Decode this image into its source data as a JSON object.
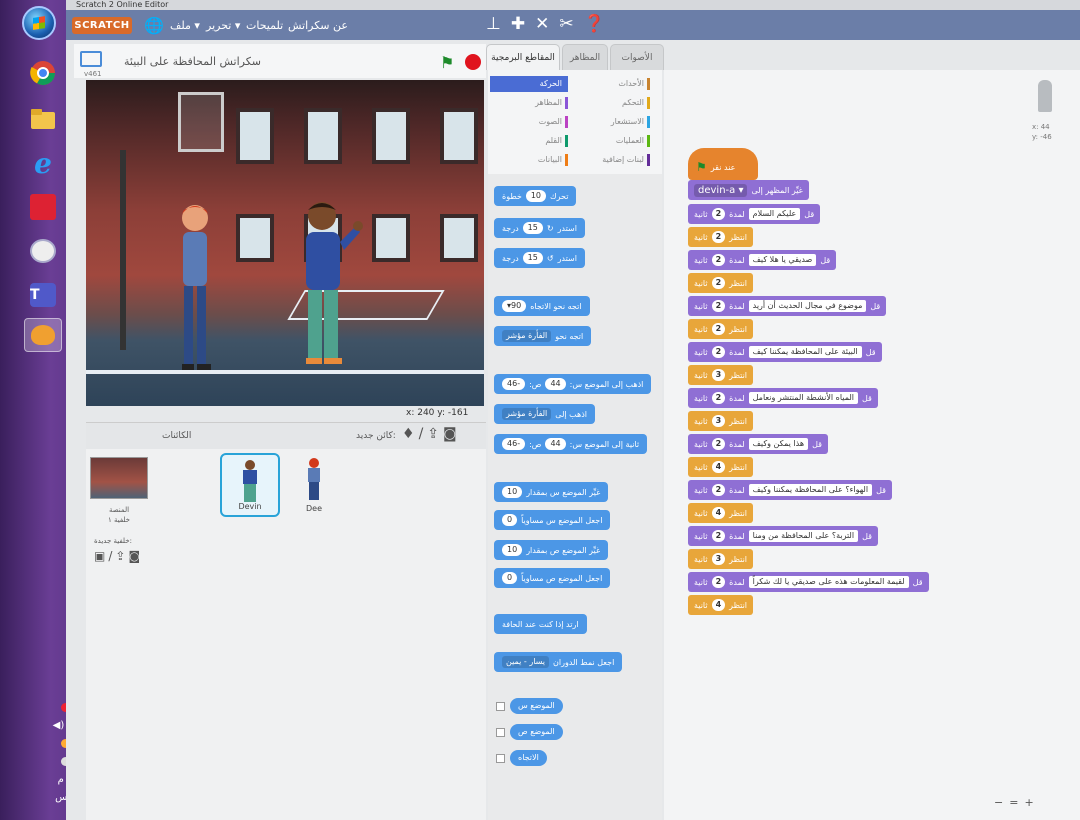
{
  "window": {
    "title": "Scratch 2 Online Editor"
  },
  "taskbar": {
    "language": "EN",
    "clock": "٦:١٥ م",
    "day": "الخميس"
  },
  "menubar": {
    "logo": "SCRATCH",
    "file": "ملف ▾",
    "edit": "تحرير ▾",
    "tips": "تلميحات",
    "about": "عن سكراتش"
  },
  "stage": {
    "project_name": "سكراتش المحافظة على البيئة",
    "version": "v461",
    "x_label": "x:",
    "x_value": "240",
    "y_label": "y:",
    "y_value": "-161"
  },
  "sprites": {
    "header": "الكائنات",
    "new_sprite": "كائن جديد:",
    "stage_label": "المنصة",
    "stage_backdrops": "خلفية ١",
    "new_backdrop": "خلفية جديدة:",
    "items": [
      {
        "name": "Devin"
      },
      {
        "name": "Dee"
      }
    ]
  },
  "tabs": {
    "scripts": "المقاطع البرمجية",
    "costumes": "المظاهر",
    "sounds": "الأصوات"
  },
  "categories": [
    {
      "label": "الحركة",
      "color": "#4a6cd4",
      "active": true
    },
    {
      "label": "الأحداث",
      "color": "#c88330"
    },
    {
      "label": "المظاهر",
      "color": "#8a55d7"
    },
    {
      "label": "التحكم",
      "color": "#e1a91a"
    },
    {
      "label": "الصوت",
      "color": "#bb42c3"
    },
    {
      "label": "الاستشعار",
      "color": "#2ca5e2"
    },
    {
      "label": "القلم",
      "color": "#0e9a6c"
    },
    {
      "label": "العمليات",
      "color": "#5cb712"
    },
    {
      "label": "البيانات",
      "color": "#ee7d16"
    },
    {
      "label": "لبنات إضافية",
      "color": "#632d99"
    }
  ],
  "palette": {
    "move": {
      "a": "تحرك",
      "n": "10",
      "b": "خطوة"
    },
    "turn_right": {
      "a": "استدر",
      "n": "15",
      "b": "درجة"
    },
    "turn_left": {
      "a": "استدر",
      "n": "15",
      "b": "درجة"
    },
    "point_dir": {
      "a": "اتجه نحو الاتجاه",
      "n": "90▾"
    },
    "point_towards": {
      "a": "اتجه نحو",
      "d": "الفأرة مؤشر"
    },
    "goto_xy": {
      "a": "اذهب إلى الموضع س:",
      "x": "44",
      "b": "ص:",
      "y": "-46"
    },
    "goto": {
      "a": "اذهب إلى",
      "d": "الفأرة مؤشر"
    },
    "glide": {
      "a": "ثانية إلى الموضع س:",
      "x": "44",
      "b": "ص:",
      "y": "-46"
    },
    "change_x": {
      "a": "غيِّر الموضع س بمقدار",
      "n": "10"
    },
    "set_x": {
      "a": "اجعل الموضع س مساوياً",
      "n": "0"
    },
    "change_y": {
      "a": "غيِّر الموضع ص بمقدار",
      "n": "10"
    },
    "set_y": {
      "a": "اجعل الموضع ص مساوياً",
      "n": "0"
    },
    "bounce": {
      "a": "ارتد إذا كنت عند الحافة"
    },
    "rotation": {
      "a": "اجعل نمط الدوران",
      "d": "يسار - يمين"
    },
    "rep_x": "الموضع س",
    "rep_y": "الموضع ص",
    "rep_dir": "الاتجاه"
  },
  "script": {
    "hat": "عند نقر",
    "switch": {
      "a": "غيِّر المظهر إلى",
      "d": "devin-a ▾"
    },
    "say_label": "قل",
    "for_label": "لمدة",
    "sec_label": "ثانية",
    "wait_label": "انتظر",
    "lines": [
      {
        "say": "عليكم السلام",
        "say_n": "2",
        "wait_n": "2"
      },
      {
        "say": "صديقي يا هلا كيف",
        "say_n": "2",
        "wait_n": "2"
      },
      {
        "say": "موضوع في مجال الحديث أن أريد",
        "say_n": "2",
        "wait_n": "2"
      },
      {
        "say": "البيئة على المحافظة يمكننا كيف",
        "say_n": "2",
        "wait_n": "3"
      },
      {
        "say": "المياه الأنشطة المنتشر ونعامل",
        "say_n": "2",
        "wait_n": "3"
      },
      {
        "say": "هذا يمكن وكيف",
        "say_n": "2",
        "wait_n": "4"
      },
      {
        "say": "الهواء؟ على المحافظة يمكننا وكيف",
        "say_n": "2",
        "wait_n": "4"
      },
      {
        "say": "التربة؟ على المحافظة من ومنا",
        "say_n": "2",
        "wait_n": "3"
      },
      {
        "say": "لقيمة المعلومات هذه على صديقي يا لك شكراً",
        "say_n": "2",
        "wait_n": "4"
      }
    ],
    "sprite_x": "x: 44",
    "sprite_y": "y: -46"
  },
  "colors": {
    "motion": "#4c97e6",
    "looks": "#8f6fd4",
    "control": "#e8a63a",
    "events": "#e6842d"
  }
}
